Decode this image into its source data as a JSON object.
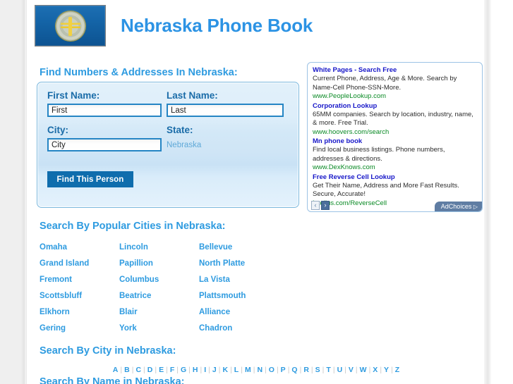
{
  "site": {
    "title": "Nebraska Phone Book",
    "flag_icon": "nebraska-flag-icon"
  },
  "sections": {
    "find_heading": "Find Numbers & Addresses In Nebraska:",
    "popular_cities_heading": "Search By Popular Cities in Nebraska:",
    "city_heading": "Search By City in Nebraska:",
    "name_heading": "Search By Name in Nebraska:"
  },
  "search_form": {
    "first_name_label": "First Name:",
    "first_name_value": "First",
    "first_name_placeholder": "First",
    "last_name_label": "Last Name:",
    "last_name_value": "Last",
    "last_name_placeholder": "Last",
    "city_label": "City:",
    "city_value": "City",
    "city_placeholder": "City",
    "state_label": "State:",
    "state_value": "Nebraska",
    "submit_label": "Find This Person"
  },
  "ads": {
    "items": [
      {
        "title": "White Pages - Search Free",
        "desc": "Current Phone, Address, Age & More. Search by Name-Cell Phone-SSN-More.",
        "url": "www.PeopleLookup.com"
      },
      {
        "title": "Corporation Lookup",
        "desc": "65MM companies. Search by location, industry, name, & more. Free Trial.",
        "url": "www.hoovers.com/search"
      },
      {
        "title": "Mn phone book",
        "desc": "Find local business listings. Phone numbers, addresses & directions.",
        "url": "www.DexKnows.com"
      },
      {
        "title": "Free Reverse Cell Lookup",
        "desc": "Get Their Name, Address and More Fast Results. Secure, Accurate!",
        "url": "Intelius.com/ReverseCell"
      }
    ],
    "prev_label": "‹",
    "next_label": "›",
    "adchoices_label": "AdChoices",
    "adchoices_icon": "triangle-right-icon"
  },
  "popular_cities": [
    [
      "Omaha",
      "Lincoln",
      "Bellevue"
    ],
    [
      "Grand Island",
      "Papillion",
      "North Platte"
    ],
    [
      "Fremont",
      "Columbus",
      "La Vista"
    ],
    [
      "Scottsbluff",
      "Beatrice",
      "Plattsmouth"
    ],
    [
      "Elkhorn",
      "Blair",
      "Alliance"
    ],
    [
      "Gering",
      "York",
      "Chadron"
    ]
  ],
  "alphabet": [
    "A",
    "B",
    "C",
    "D",
    "E",
    "F",
    "G",
    "H",
    "I",
    "J",
    "K",
    "L",
    "M",
    "N",
    "O",
    "P",
    "Q",
    "R",
    "S",
    "T",
    "U",
    "V",
    "W",
    "X",
    "Y",
    "Z"
  ],
  "colors": {
    "accent_blue": "#2e9be0",
    "label_blue": "#1a6ca8",
    "button_blue": "#0f6dad",
    "ad_title_blue": "#1616c8",
    "ad_url_green": "#0a8a25",
    "adchoices_bg": "#5f7da3"
  }
}
